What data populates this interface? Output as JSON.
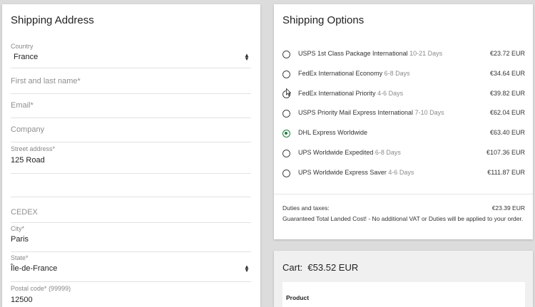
{
  "shipping_address": {
    "title": "Shipping Address",
    "country": {
      "label": "Country",
      "value": "France"
    },
    "name": {
      "placeholder": "First and last name*"
    },
    "email": {
      "placeholder": "Email*"
    },
    "company": {
      "placeholder": "Company"
    },
    "street": {
      "label": "Street address*",
      "value": "125 Road"
    },
    "address2": {
      "value": ""
    },
    "cedex": {
      "placeholder": "CEDEX"
    },
    "city": {
      "label": "City*",
      "value": "Paris"
    },
    "state": {
      "label": "State*",
      "value": "Île-de-France"
    },
    "postal": {
      "label": "Postal code*",
      "hint": "(99999)",
      "value": "12500"
    }
  },
  "shipping_options": {
    "title": "Shipping Options",
    "options": [
      {
        "name": "USPS 1st Class Package International",
        "days": "10-21 Days",
        "price": "€23.72 EUR",
        "selected": false
      },
      {
        "name": "FedEx International Economy",
        "days": "6-8 Days",
        "price": "€34.64 EUR",
        "selected": false
      },
      {
        "name": "FedEx International Priority",
        "days": "4-6 Days",
        "price": "€39.82 EUR",
        "selected": false
      },
      {
        "name": "USPS Priority Mail Express International",
        "days": "7-10 Days",
        "price": "€62.04 EUR",
        "selected": false
      },
      {
        "name": "DHL Express Worldwide",
        "days": "",
        "price": "€63.40 EUR",
        "selected": true
      },
      {
        "name": "UPS Worldwide Expedited",
        "days": "6-8 Days",
        "price": "€107.36 EUR",
        "selected": false
      },
      {
        "name": "UPS Worldwide Express Saver",
        "days": "4-6 Days",
        "price": "€111.87 EUR",
        "selected": false
      }
    ],
    "duties_label": "Duties and taxes:",
    "duties_price": "€23.39 EUR",
    "guarantee": "Guaranteed Total Landed Cost! - No additional VAT or Duties will be applied to your order."
  },
  "cart": {
    "title": "Cart:",
    "total": "€53.52 EUR",
    "column_product": "Product"
  },
  "colors": {
    "accent": "#1e7d3c",
    "background": "#dcdcdc"
  }
}
